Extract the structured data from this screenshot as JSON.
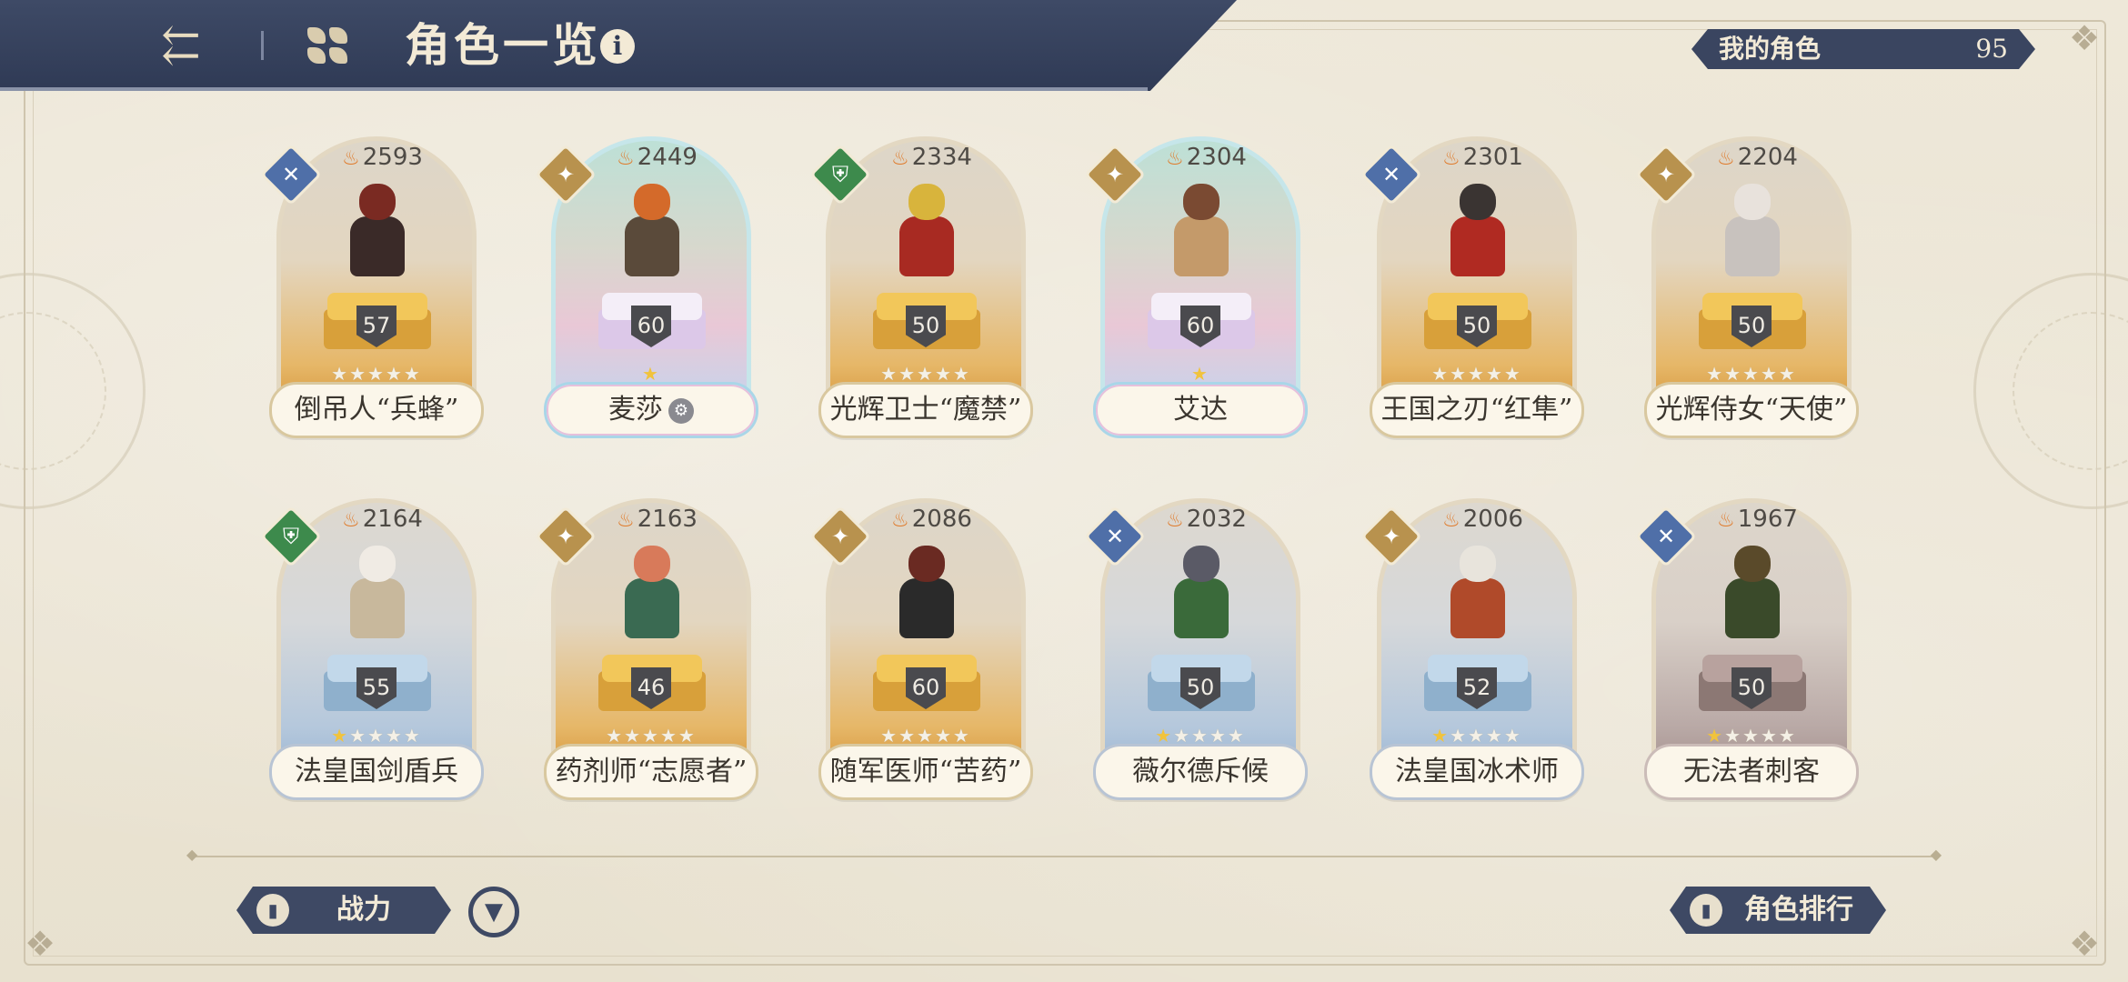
{
  "header": {
    "title": "角色一览",
    "info_icon": "i",
    "back_icon": "back-arrow-icon",
    "menu_icon": "grid-menu-icon"
  },
  "my_characters": {
    "label": "我的角色",
    "count": "95"
  },
  "cards": [
    {
      "power": "2593",
      "level": "57",
      "name": "倒吊人“兵蜂”",
      "stars": 5,
      "class": "ranged",
      "theme": "gold"
    },
    {
      "power": "2449",
      "level": "60",
      "name": "麦莎",
      "name_badge": "⚙",
      "stars": 1,
      "class": "support",
      "theme": "rainbow"
    },
    {
      "power": "2334",
      "level": "50",
      "name": "光辉卫士“魔禁”",
      "stars": 5,
      "class": "tank",
      "theme": "gold"
    },
    {
      "power": "2304",
      "level": "60",
      "name": "艾达",
      "stars": 1,
      "class": "support",
      "theme": "rainbow"
    },
    {
      "power": "2301",
      "level": "50",
      "name": "王国之刃“红隼”",
      "stars": 5,
      "class": "ranged",
      "theme": "gold"
    },
    {
      "power": "2204",
      "level": "50",
      "name": "光辉侍女“天使”",
      "stars": 5,
      "class": "support",
      "theme": "gold"
    },
    {
      "power": "2164",
      "level": "55",
      "name": "法皇国剑盾兵",
      "stars": 5,
      "class": "tank",
      "theme": "blue"
    },
    {
      "power": "2163",
      "level": "46",
      "name": "药剂师“志愿者”",
      "stars": 5,
      "class": "support",
      "theme": "gold"
    },
    {
      "power": "2086",
      "level": "60",
      "name": "随军医师“苦药”",
      "stars": 5,
      "class": "support",
      "theme": "gold"
    },
    {
      "power": "2032",
      "level": "50",
      "name": "薇尔德斥候",
      "stars": 5,
      "class": "ranged",
      "theme": "blue"
    },
    {
      "power": "2006",
      "level": "52",
      "name": "法皇国冰术师",
      "stars": 5,
      "class": "support",
      "theme": "blue"
    },
    {
      "power": "1967",
      "level": "50",
      "name": "无法者刺客",
      "stars": 5,
      "class": "ranged",
      "theme": "brown"
    }
  ],
  "footer": {
    "sort_label": "战力",
    "ranking_label": "角色排行"
  },
  "colors": {
    "header_bg": "#2f3a55",
    "accent_gold": "#d89b42",
    "star": "#f1c33c"
  }
}
